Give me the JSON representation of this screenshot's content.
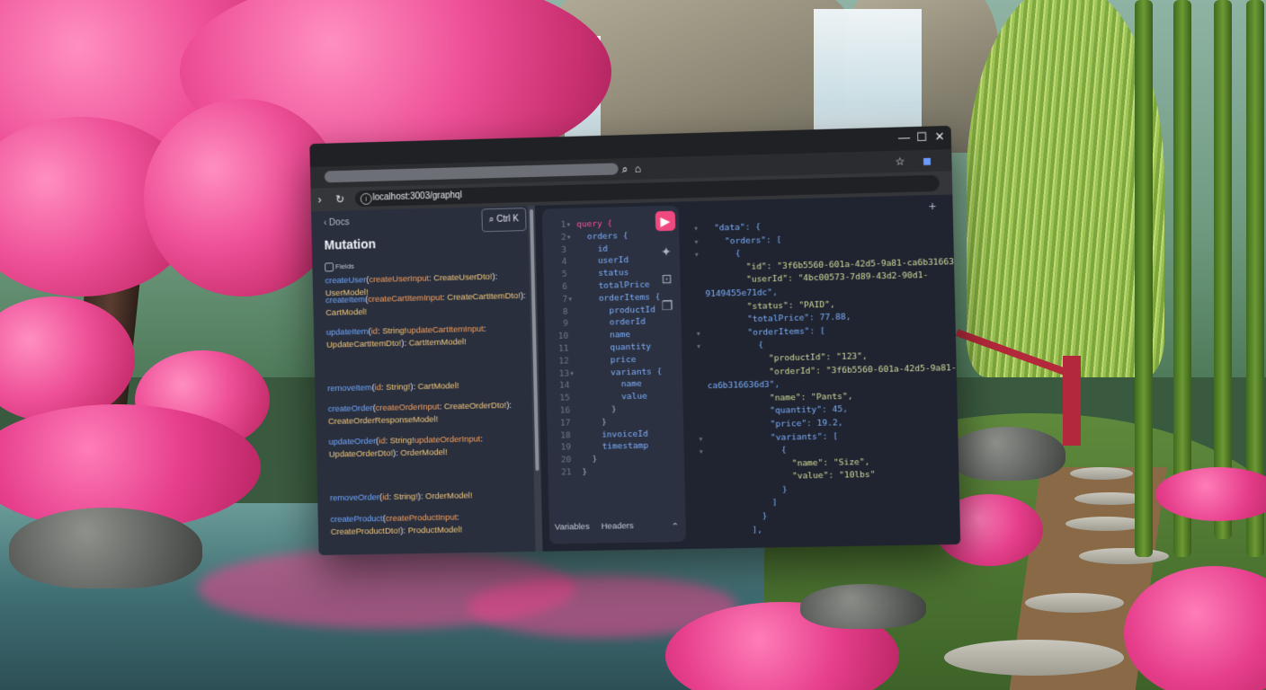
{
  "browser": {
    "url": "localhost:3003/graphql",
    "controls": {
      "minimize": "—",
      "maximize": "☐",
      "close": "✕"
    }
  },
  "docs": {
    "back_label": "Docs",
    "search_shortcut": "Ctrl K",
    "title": "Mutation",
    "fields_label": "Fields",
    "fields": [
      {
        "parts": [
          [
            "n",
            "createUser"
          ],
          [
            "p",
            "("
          ],
          [
            "a",
            "createUserInput"
          ],
          [
            "p",
            ": "
          ],
          [
            "t",
            "CreateUserDto!"
          ],
          [
            "p",
            "): "
          ],
          [
            "r",
            "UserModel!"
          ]
        ]
      },
      {
        "parts": [
          [
            "n",
            "createItem"
          ],
          [
            "p",
            "("
          ],
          [
            "a",
            "createCartItemInput"
          ],
          [
            "p",
            ": "
          ],
          [
            "t",
            "CreateCartItemDto!"
          ],
          [
            "p",
            "): "
          ],
          [
            "r",
            "CartModel!"
          ]
        ]
      },
      {
        "parts": [
          [
            "n",
            "updateItem"
          ],
          [
            "p",
            "("
          ],
          [
            "a",
            "id"
          ],
          [
            "p",
            ": "
          ],
          [
            "t",
            "String!"
          ],
          [
            "a",
            "updateCartItemInput"
          ],
          [
            "p",
            ": "
          ],
          [
            "t",
            "UpdateCartItemDto!"
          ],
          [
            "p",
            "): "
          ],
          [
            "r",
            "CartItemModel!"
          ]
        ]
      },
      {
        "parts": [
          [
            "n",
            "removeItem"
          ],
          [
            "p",
            "("
          ],
          [
            "a",
            "id"
          ],
          [
            "p",
            ": "
          ],
          [
            "t",
            "String!"
          ],
          [
            "p",
            "): "
          ],
          [
            "r",
            "CartModel!"
          ]
        ]
      },
      {
        "parts": [
          [
            "n",
            "createOrder"
          ],
          [
            "p",
            "("
          ],
          [
            "a",
            "createOrderInput"
          ],
          [
            "p",
            ": "
          ],
          [
            "t",
            "CreateOrderDto!"
          ],
          [
            "p",
            "): "
          ],
          [
            "r",
            "CreateOrderResponseModel!"
          ]
        ]
      },
      {
        "parts": [
          [
            "n",
            "updateOrder"
          ],
          [
            "p",
            "("
          ],
          [
            "a",
            "id"
          ],
          [
            "p",
            ": "
          ],
          [
            "t",
            "String!"
          ],
          [
            "a",
            "updateOrderInput"
          ],
          [
            "p",
            ": "
          ],
          [
            "t",
            "UpdateOrderDto!"
          ],
          [
            "p",
            "): "
          ],
          [
            "r",
            "OrderModel!"
          ]
        ]
      },
      {
        "parts": [
          [
            "n",
            "removeOrder"
          ],
          [
            "p",
            "("
          ],
          [
            "a",
            "id"
          ],
          [
            "p",
            ": "
          ],
          [
            "t",
            "String!"
          ],
          [
            "p",
            "): "
          ],
          [
            "r",
            "OrderModel!"
          ]
        ]
      },
      {
        "parts": [
          [
            "n",
            "createProduct"
          ],
          [
            "p",
            "("
          ],
          [
            "a",
            "createProductInput"
          ],
          [
            "p",
            ": "
          ],
          [
            "t",
            "CreateProductDto!"
          ],
          [
            "p",
            "): "
          ],
          [
            "r",
            "ProductModel!"
          ]
        ]
      }
    ]
  },
  "editor": {
    "lines": [
      {
        "n": "1",
        "fold": "▾",
        "text": "query {",
        "kind": "kw"
      },
      {
        "n": "2",
        "fold": "▾",
        "text": "  orders {",
        "kind": "fld"
      },
      {
        "n": "3",
        "fold": "",
        "text": "    id",
        "kind": "fld"
      },
      {
        "n": "4",
        "fold": "",
        "text": "    userId",
        "kind": "fld"
      },
      {
        "n": "5",
        "fold": "",
        "text": "    status",
        "kind": "fld"
      },
      {
        "n": "6",
        "fold": "",
        "text": "    totalPrice",
        "kind": "fld"
      },
      {
        "n": "7",
        "fold": "▾",
        "text": "    orderItems {",
        "kind": "fld"
      },
      {
        "n": "8",
        "fold": "",
        "text": "      productId",
        "kind": "fld"
      },
      {
        "n": "9",
        "fold": "",
        "text": "      orderId",
        "kind": "fld"
      },
      {
        "n": "10",
        "fold": "",
        "text": "      name",
        "kind": "fld"
      },
      {
        "n": "11",
        "fold": "",
        "text": "      quantity",
        "kind": "fld"
      },
      {
        "n": "12",
        "fold": "",
        "text": "      price",
        "kind": "fld"
      },
      {
        "n": "13",
        "fold": "▾",
        "text": "      variants {",
        "kind": "fld"
      },
      {
        "n": "14",
        "fold": "",
        "text": "        name",
        "kind": "fld"
      },
      {
        "n": "15",
        "fold": "",
        "text": "        value",
        "kind": "fld"
      },
      {
        "n": "16",
        "fold": "",
        "text": "      }",
        "kind": "pun"
      },
      {
        "n": "17",
        "fold": "",
        "text": "    }",
        "kind": "pun"
      },
      {
        "n": "18",
        "fold": "",
        "text": "    invoiceId",
        "kind": "fld"
      },
      {
        "n": "19",
        "fold": "",
        "text": "    timestamp",
        "kind": "fld"
      },
      {
        "n": "20",
        "fold": "",
        "text": "  }",
        "kind": "pun"
      },
      {
        "n": "21",
        "fold": "",
        "text": "}",
        "kind": "pun"
      }
    ],
    "tabs": {
      "variables": "Variables",
      "headers": "Headers",
      "collapse": "⌃"
    }
  },
  "result": {
    "lines": [
      {
        "arrow": "▾",
        "html": "{"
      },
      {
        "arrow": "▾",
        "text": "  \"data\": {"
      },
      {
        "arrow": "▾",
        "text": "    \"orders\": ["
      },
      {
        "arrow": "▾",
        "text": "      {"
      },
      {
        "arrow": "",
        "text": "        \"id\": \"3f6b5560-601a-42d5-9a81-ca6b31663"
      },
      {
        "arrow": "",
        "text": "        \"userId\": \"4bc00573-7d89-43d2-90d1-"
      },
      {
        "arrow": "",
        "text": "9149455e71dc\","
      },
      {
        "arrow": "",
        "text": "        \"status\": \"PAID\","
      },
      {
        "arrow": "",
        "text": "        \"totalPrice\": 77.88,"
      },
      {
        "arrow": "▾",
        "text": "        \"orderItems\": ["
      },
      {
        "arrow": "▾",
        "text": "          {"
      },
      {
        "arrow": "",
        "text": "            \"productId\": \"123\","
      },
      {
        "arrow": "",
        "text": "            \"orderId\": \"3f6b5560-601a-42d5-9a81-"
      },
      {
        "arrow": "",
        "text": "ca6b316636d3\","
      },
      {
        "arrow": "",
        "text": "            \"name\": \"Pants\","
      },
      {
        "arrow": "",
        "text": "            \"quantity\": 45,"
      },
      {
        "arrow": "",
        "text": "            \"price\": 19.2,"
      },
      {
        "arrow": "▾",
        "text": "            \"variants\": ["
      },
      {
        "arrow": "▾",
        "text": "              {"
      },
      {
        "arrow": "",
        "text": "                \"name\": \"Size\","
      },
      {
        "arrow": "",
        "text": "                \"value\": \"10lbs\""
      },
      {
        "arrow": "",
        "text": "              }"
      },
      {
        "arrow": "",
        "text": "            ]"
      },
      {
        "arrow": "",
        "text": "          }"
      },
      {
        "arrow": "",
        "text": "        ],"
      }
    ]
  }
}
